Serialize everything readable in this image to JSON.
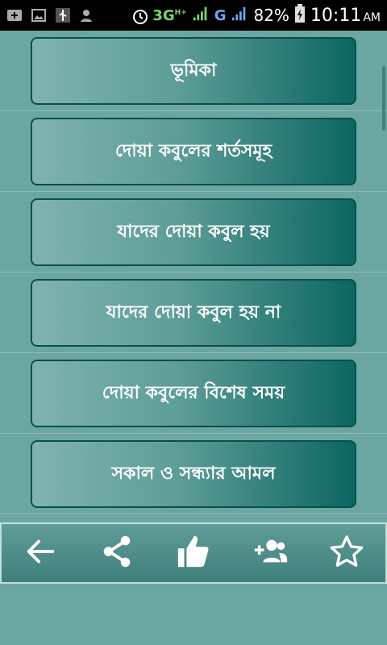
{
  "status_bar": {
    "network_label": "3G",
    "network_sup": "H+",
    "carrier_label": "G",
    "battery_percent": "82%",
    "time": "10:11",
    "ampm": "AM"
  },
  "menu": {
    "items": [
      {
        "label": "ভূমিকা"
      },
      {
        "label": "দোয়া কবুলের শর্তসমূহ"
      },
      {
        "label": "যাদের দোয়া কবুল হয়"
      },
      {
        "label": "যাদের দোয়া কবুল হয় না"
      },
      {
        "label": "দোয়া কবুলের বিশেষ সময়"
      },
      {
        "label": "সকাল ও সন্ধ্যার আমল"
      }
    ]
  },
  "toolbar": {
    "icons": [
      "back-arrow-icon",
      "share-icon",
      "thumbs-up-icon",
      "add-user-icon",
      "star-icon"
    ]
  },
  "colors": {
    "background": "#6aa7a3",
    "button_dark": "#0c6661",
    "button_border": "#0b4e4a"
  }
}
